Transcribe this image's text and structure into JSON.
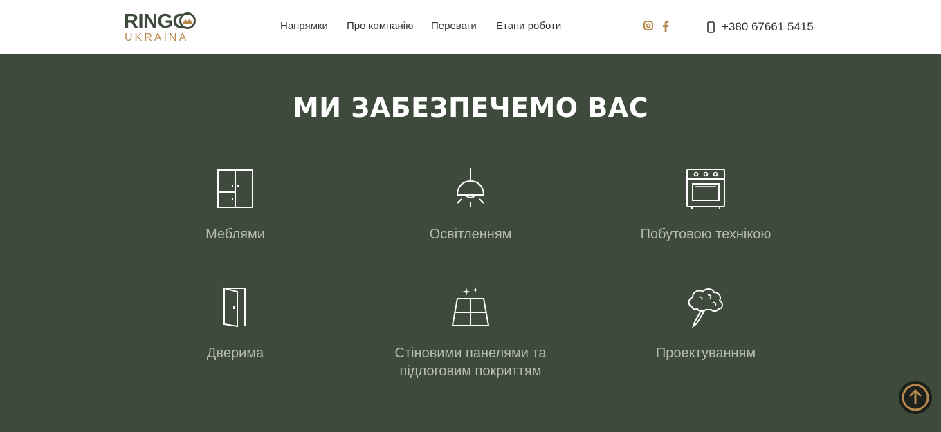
{
  "header": {
    "logo": {
      "title": "RINGO",
      "subtitle": "UKRAINA"
    },
    "nav": [
      {
        "label": "Напрямки"
      },
      {
        "label": "Про компанію"
      },
      {
        "label": "Переваги"
      },
      {
        "label": "Етапи роботи"
      }
    ],
    "social": [
      {
        "icon": "instagram-icon"
      },
      {
        "icon": "facebook-icon"
      }
    ],
    "phone": {
      "icon": "mobile-phone-icon",
      "number": "+380 67661 5415"
    }
  },
  "main": {
    "title": "МИ ЗАБЕЗПЕЧЕМО ВАС",
    "services": [
      {
        "icon": "wardrobe-icon",
        "label": "Меблями"
      },
      {
        "icon": "ceiling-lamp-icon",
        "label": "Освітленням"
      },
      {
        "icon": "oven-icon",
        "label": "Побутовою технікою"
      },
      {
        "icon": "door-icon",
        "label": "Дверима"
      },
      {
        "icon": "floor-tiles-icon",
        "label": "Стіновими панелями та підлоговим покриттям"
      },
      {
        "icon": "brain-pencil-icon",
        "label": "Проектуванням"
      }
    ]
  },
  "scroll_top": {
    "icon": "arrow-up-circle-icon"
  },
  "colors": {
    "background": "#3e4a3b",
    "header": "#ffffff",
    "accent": "#b88a4e",
    "label": "#b7bbb3",
    "title": "#ffffff"
  }
}
